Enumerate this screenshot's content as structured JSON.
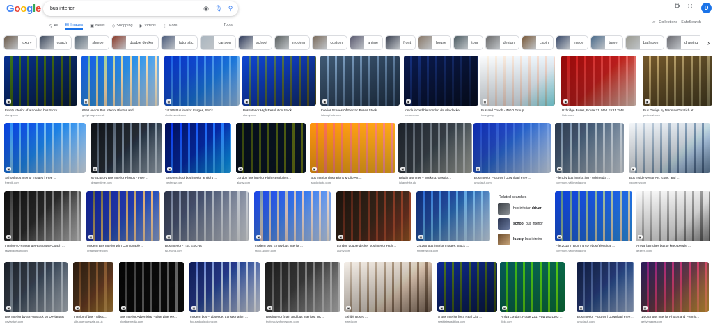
{
  "header": {
    "search_query": "bus interior",
    "avatar_letter": "D"
  },
  "tabs": [
    {
      "label": "All",
      "icon": "search-icon",
      "active": false
    },
    {
      "label": "Images",
      "icon": "image-icon",
      "active": true
    },
    {
      "label": "News",
      "icon": "news-icon",
      "active": false
    },
    {
      "label": "Shopping",
      "icon": "tag-icon",
      "active": false
    },
    {
      "label": "Videos",
      "icon": "play-icon",
      "active": false
    },
    {
      "label": "More",
      "icon": "more-vertical-icon",
      "active": false
    }
  ],
  "tools_label": "Tools",
  "collections_label": "Collections",
  "safesearch_label": "SafeSearch",
  "chips": [
    "luxury",
    "coach",
    "sleeper",
    "double decker",
    "futuristic",
    "cartoon",
    "school",
    "modern",
    "custom",
    "anime",
    "front",
    "house",
    "tour",
    "design",
    "cabin",
    "inside",
    "travel",
    "bathroom",
    "drawing"
  ],
  "related": {
    "title": "Related searches",
    "items": [
      {
        "prefix": "bus interior",
        "bold": "driver",
        "bold_first": false
      },
      {
        "prefix": "bus interior",
        "bold": "school",
        "bold_first": true
      },
      {
        "prefix": "bus interior",
        "bold": "luxury",
        "bold_first": true
      }
    ]
  },
  "results": [
    {
      "title": "Empty interior of a London bus Stock ...",
      "source": "alamy.com"
    },
    {
      "title": "669 London Bus Interior Photos and ...",
      "source": "gettyimages.co.uk"
    },
    {
      "title": "24,266 Bus interior Images, Stock ...",
      "source": "shutterstock.com"
    },
    {
      "title": "Bus Interior High Resolution Stock ...",
      "source": "alamy.com"
    },
    {
      "title": "Interior Scenes Of Electric Buses Stock ...",
      "source": "istockphoto.com"
    },
    {
      "title": "Inside incredible London double-decker ...",
      "source": "mirror.co.uk"
    },
    {
      "title": "Bus and Coach - INGO Group",
      "source": "ines.group"
    },
    {
      "title": "Uxbridge Buses, Route 31, MA1 FK81 XMS ...",
      "source": "flickr.com"
    },
    {
      "title": "Bus Design by Miroslav Dorotich at ...",
      "source": "pinterest.com"
    },
    {
      "title": "School Bus Interior Images | Free ...",
      "source": "freepik.com"
    },
    {
      "title": "673 Luxury Bus Interior Photos - Free ...",
      "source": "dreamstime.com"
    },
    {
      "title": "Empty school bus interior at night ...",
      "source": "vecteezy.com"
    },
    {
      "title": "London bus interior High Resolution ...",
      "source": "alamy.com"
    },
    {
      "title": "Bus Interior Illustrations & Clip Art ...",
      "source": "istockphoto.com"
    },
    {
      "title": "Britain Bummer ~ Walking, Gossip ...",
      "source": "julianwhite.uk"
    },
    {
      "title": "Bus Interior Pictures | Download Free ...",
      "source": "unsplash.com"
    },
    {
      "title": "File:City bus interior.jpg - Wikimedia ...",
      "source": "commons.wikimedia.org"
    },
    {
      "title": "Bus Inside Vector Art, Icons, and ...",
      "source": "vecteezy.com"
    },
    {
      "title": "Interior-40-Passenger-Executive-Coach ...",
      "source": "tanabiadeltan.com"
    },
    {
      "title": "Modern Bus Interior with Comfortable ...",
      "source": "dreamstime.com"
    },
    {
      "title": "Bus Interior - TSL ESCHA",
      "source": "tsl-escha.com"
    },
    {
      "title": "modern bus: Empty bus interior ...",
      "source": "stock.adobe.com"
    },
    {
      "title": "London double decker bus interior High ...",
      "source": "alamy.com"
    },
    {
      "title": "24,266 Bus interior Images, Stock ...",
      "source": "shutterstock.com"
    },
    {
      "title": "File:2013 in Bonn: BYD ebus (electrical ...",
      "source": "commons.wikimedia.org"
    },
    {
      "title": "Arrival launches bus to keep people ...",
      "source": "dezeen.com"
    },
    {
      "title": "Bus Interior by SirFoxStock on DeviantArt",
      "source": "deviantart.com"
    },
    {
      "title": "Interior of bus - Albuq...",
      "source": "albuquerquestate.co.uk"
    },
    {
      "title": "Bus Interior Advertising - Blue Line Me...",
      "source": "bluelinemedia.com"
    },
    {
      "title": "modern bus -- absence, transportation ...",
      "source": "focusedcollection.com"
    },
    {
      "title": "Bus interior (train and bus interiors, UK ...",
      "source": "thebeautyofnewsporn.com"
    },
    {
      "title": "Exhibit Buses ...",
      "source": "wired.com"
    },
    {
      "title": "A Bus Interior for a Real City ...",
      "source": "seattletransitblog.com"
    },
    {
      "title": "Arriva London, Route 221, VLW181 LJ03 ...",
      "source": "flickr.com"
    },
    {
      "title": "Bus Interior Pictures | Download Free ...",
      "source": "unsplash.com"
    },
    {
      "title": "14,063 Bus Interior Photos and Premiu...",
      "source": "gettyimages.com"
    }
  ]
}
